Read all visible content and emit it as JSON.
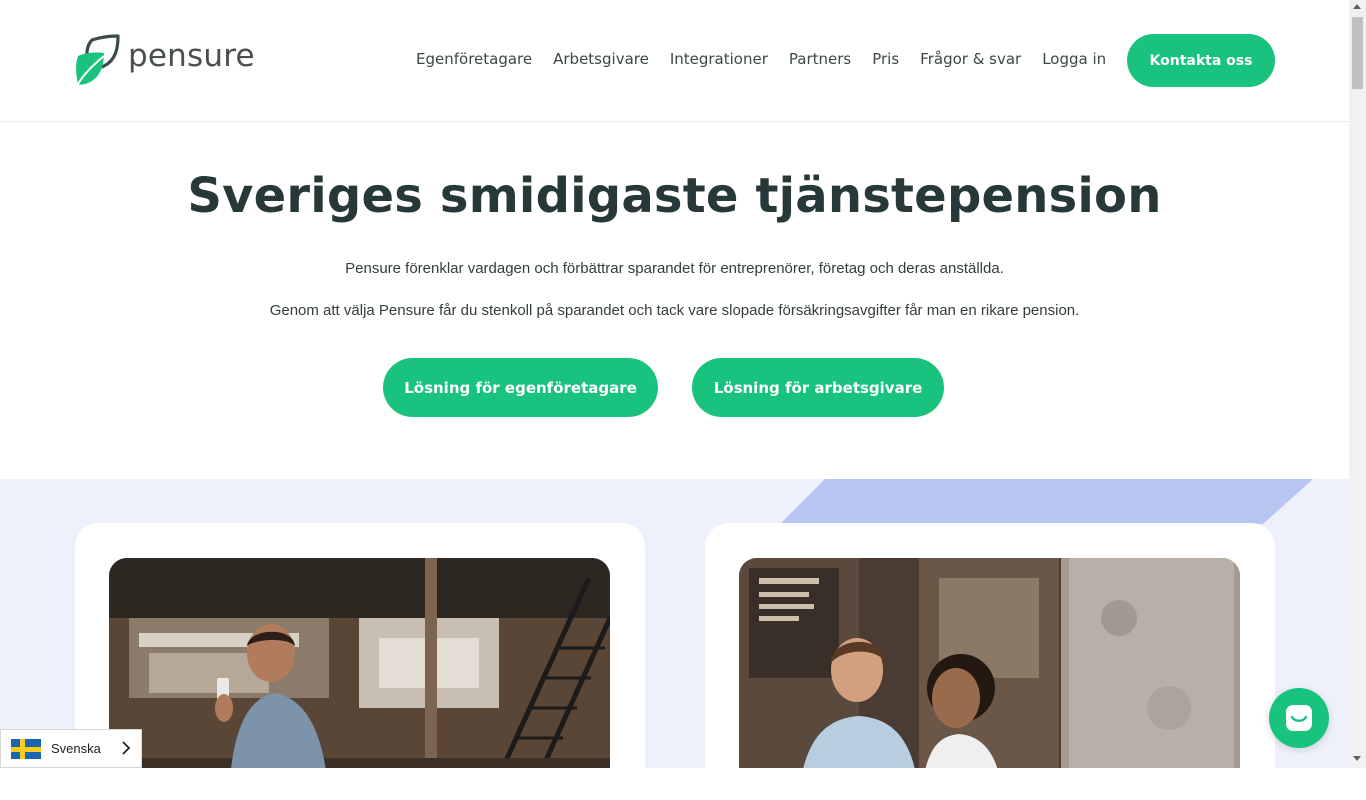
{
  "brand": {
    "name": "pensure",
    "accent": "#19c37d",
    "dark_text": "#263838"
  },
  "nav": {
    "items": [
      {
        "label": "Egenföretagare"
      },
      {
        "label": "Arbetsgivare"
      },
      {
        "label": "Integrationer"
      },
      {
        "label": "Partners"
      },
      {
        "label": "Pris"
      },
      {
        "label": "Frågor & svar"
      },
      {
        "label": "Logga in"
      }
    ],
    "cta_label": "Kontakta oss"
  },
  "hero": {
    "title": "Sveriges smidigaste tjänstepension",
    "paragraph_1": "Pensure förenklar vardagen och förbättrar sparandet för entreprenörer, företag och deras anställda.",
    "paragraph_2": "Genom att välja Pensure får du stenkoll på sparandet och tack vare slopade försäkringsavgifter får man en rikare pension.",
    "button_self_employed": "Lösning för egenföretagare",
    "button_employer": "Lösning för arbetsgivare"
  },
  "section": {
    "background": "#eef1fb",
    "stripe_color": "#b7c5f1"
  },
  "language_selector": {
    "label": "Svenska",
    "flag_icon": "sweden-flag-icon"
  },
  "chat": {
    "icon": "chat-bubble-icon"
  }
}
